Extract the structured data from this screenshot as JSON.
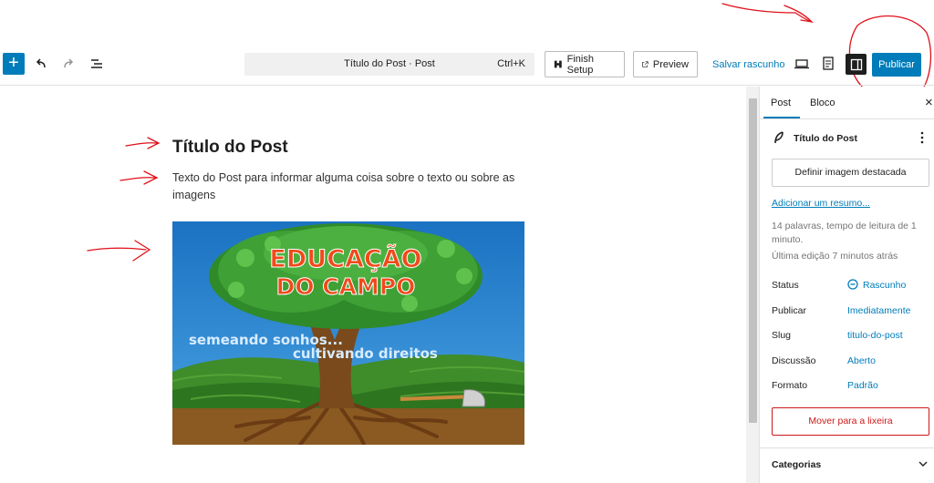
{
  "toolbar": {
    "command_title": "Título do Post · Post",
    "command_shortcut": "Ctrl+K",
    "finish_setup_label": "Finish Setup",
    "preview_label": "Preview",
    "save_draft_label": "Salvar rascunho",
    "publish_label": "Publicar"
  },
  "editor": {
    "post_title": "Título do Post",
    "post_text": "Texto do Post para informar alguma coisa sobre o texto ou sobre as imagens",
    "image": {
      "headline_line1": "EDUCAÇÃO",
      "headline_line2": "DO CAMPO",
      "caption_line1": "semeando sonhos...",
      "caption_line2": "cultivando direitos"
    }
  },
  "sidebar": {
    "tabs": [
      "Post",
      "Bloco"
    ],
    "close_icon": "×",
    "post_name": "Título do Post",
    "featured_image_button": "Definir imagem destacada",
    "add_excerpt_link": "Adicionar um resumo...",
    "stats_text": "14 palavras, tempo de leitura de 1 minuto.",
    "last_edit": "Última edição 7 minutos atrás",
    "fields": [
      {
        "label": "Status",
        "value": "Rascunho"
      },
      {
        "label": "Publicar",
        "value": "Imediatamente"
      },
      {
        "label": "Slug",
        "value": "titulo-do-post"
      },
      {
        "label": "Discussão",
        "value": "Aberto"
      },
      {
        "label": "Formato",
        "value": "Padrão"
      }
    ],
    "trash_button": "Mover para a lixeira",
    "categories_label": "Categorias"
  },
  "colors": {
    "accent": "#007cba",
    "danger": "#cc1818",
    "annotation": "#e0101a"
  },
  "icons": [
    "plus-icon",
    "undo-icon",
    "redo-icon",
    "list-view-icon",
    "setup-icon",
    "external-link-icon",
    "desktop-icon",
    "document-icon",
    "sidebar-icon",
    "close-icon",
    "feather-icon",
    "more-vertical-icon",
    "status-circle-icon",
    "chevron-down-icon"
  ]
}
